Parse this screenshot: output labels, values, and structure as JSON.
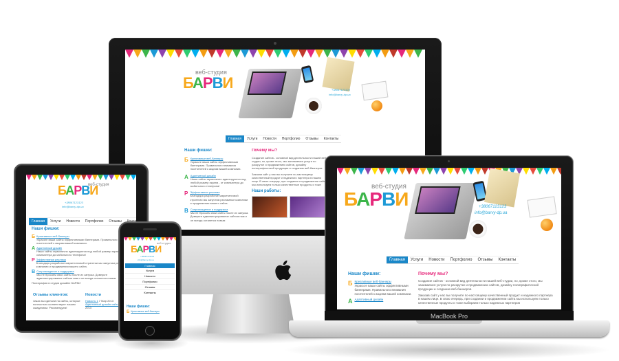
{
  "site": {
    "logo_text": [
      "Б",
      "А",
      "Р",
      "В",
      "И"
    ],
    "studio_label": "веб-студия",
    "contact_phone": "+38067123123",
    "contact_email": "info@barvy-dp.ua"
  },
  "menu": {
    "items": [
      "Главная",
      "Услуги",
      "Новости",
      "Портфолио",
      "Отзывы",
      "Контакты"
    ],
    "active": "Главная"
  },
  "features": {
    "title": "Наши фишки:",
    "items": [
      {
        "letter": "Б",
        "color": "#f7a81b",
        "title": "Креативные веб-баннеры",
        "text": "Украсьте ваши сайты эффективными баннерами. Правильного внимания посетителей к акциям вашей компании."
      },
      {
        "letter": "А",
        "color": "#3cb54a",
        "title": "Адаптивный дизайн",
        "text": "Наши сайты гармонично адаптируются под любой размер экрана - от компьютера до мобильного телефона!"
      },
      {
        "letter": "Р",
        "color": "#e6287b",
        "title": "Эффективная реклама",
        "text": "Благодаря разработке маркетинговой стратегии мы запустим рекламные компании и продвижения вашего сайта."
      },
      {
        "letter": "В",
        "color": "#1d9ad6",
        "title": "Сопровождение и поддержка",
        "text": "Мы не бросаем свои сайты после их запуска. Доверьте администрирование сайтом нам и он всегда останется новым"
      }
    ]
  },
  "why": {
    "title": "Почему мы?",
    "p1": "Создание сайтов - основной вид деятельности нашей веб-студии, но, кроме этого, мы занимаемся услуги по раскрутке и продвижению сайтов, дизайну полиграфической продукции и созданию веб-баннеров.",
    "p2": "Заказав сайт у нас вы получите по-настоящему качественный продукт и надежного партнера в нашем лице. В свою очередь, при создании и продвижении сайта мы используем только качественные продукты и тоже выбираем только надежных партнеров"
  },
  "works": {
    "title": "Наши работы:"
  },
  "clients": {
    "title": "Отзывы клиентов:",
    "text": "Заказ вы сделали на сайты, которые полностью соответствуют нашим ожиданиям. Рекомендуем!"
  },
  "news": {
    "title": "Новости",
    "items": [
      {
        "title": "Новость 1",
        "date": "7 Мар 2013"
      },
      {
        "title": "Адаптивный дизайн сайтов",
        "date": "5 Мар 2013"
      }
    ]
  },
  "partners_text": "Полиграфия в студии дизайне БАРВИ",
  "devices": {
    "macbook_label": "MacBook Pro"
  },
  "colors": {
    "accent": "#1a87c8",
    "pink": "#e6287b",
    "orange": "#f7a81b",
    "green": "#3cb54a",
    "blue": "#1d9ad6",
    "bunting": [
      "#e6287b",
      "#f7a81b",
      "#3cb54a",
      "#1d9ad6",
      "#8e44ad",
      "#ffdd00",
      "#e74c3c",
      "#2ecc71",
      "#00aeef",
      "#f39c12",
      "#c0392b"
    ]
  },
  "icons": [
    "apple-logo-icon",
    "camera-dot-icon",
    "home-button-icon"
  ]
}
